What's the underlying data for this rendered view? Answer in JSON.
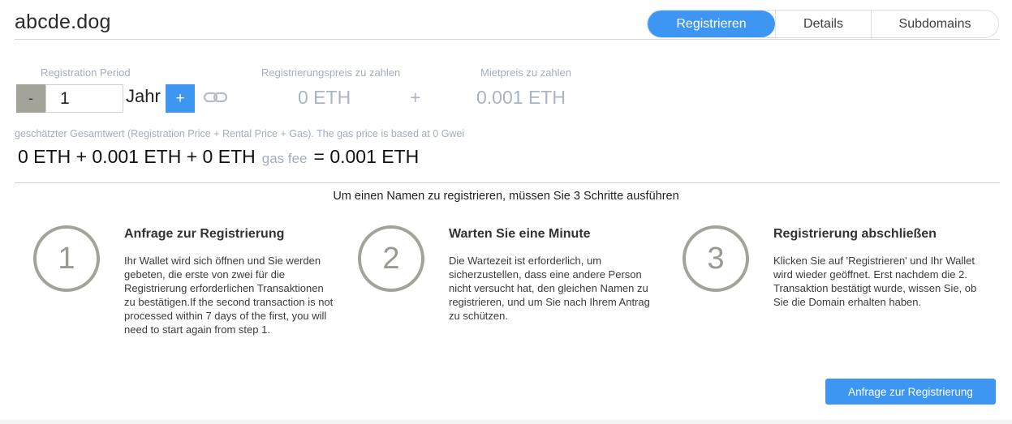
{
  "domain": "abcde.dog",
  "tabs": [
    {
      "label": "Registrieren",
      "active": true
    },
    {
      "label": "Details",
      "active": false
    },
    {
      "label": "Subdomains",
      "active": false
    }
  ],
  "period": {
    "label": "Registration Period",
    "minus": "-",
    "value": "1",
    "unit": "Jahr",
    "plus": "+",
    "link_icon": "link-icon"
  },
  "pricing": {
    "registration_label": "Registrierungspreis zu zahlen",
    "registration_value": "0 ETH",
    "plus": "+",
    "rent_label": "Mietpreis zu zahlen",
    "rent_value": "0.001 ETH"
  },
  "estimate": {
    "label": "geschätzter Gesamtwert (Registration Price + Rental Price + Gas). The gas price is based at 0 Gwei",
    "expression": "0 ETH + 0.001 ETH + 0 ETH",
    "gas_fee": "gas fee",
    "total": "= 0.001 ETH"
  },
  "steps_heading": "Um einen Namen zu registrieren, müssen Sie 3 Schritte ausführen",
  "steps": [
    {
      "number": "1",
      "title": "Anfrage zur Registrierung",
      "body": "Ihr Wallet wird sich öffnen und Sie werden gebeten, die erste von zwei für die Registrierung erforderlichen Transaktionen zu bestätigen.If the second transaction is not processed within 7 days of the first, you will need to start again from step 1."
    },
    {
      "number": "2",
      "title": "Warten Sie eine Minute",
      "body": "Die Wartezeit ist erforderlich, um sicherzustellen, dass eine andere Person nicht versucht hat, den gleichen Namen zu registrieren, und um Sie nach Ihrem Antrag zu schützen."
    },
    {
      "number": "3",
      "title": "Registrierung abschließen",
      "body": "Klicken Sie auf 'Registrieren' und Ihr Wallet wird wieder geöffnet. Erst nachdem die 2. Transaktion bestätigt wurde, wissen Sie, ob Sie die Domain erhalten haben."
    }
  ],
  "action_button": "Anfrage zur Registrierung",
  "colors": {
    "accent": "#3e96f3",
    "muted_text": "#a3adbd",
    "stepper_gray": "#a3a39a"
  }
}
